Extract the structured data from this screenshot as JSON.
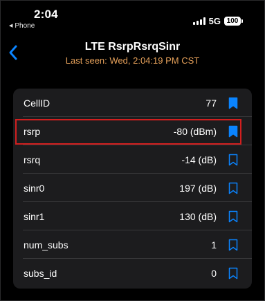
{
  "status_bar": {
    "time": "2:04",
    "back_app": "Phone",
    "network": "5G",
    "battery": "100"
  },
  "header": {
    "title": "LTE RsrpRsrqSinr",
    "last_seen": "Last seen: Wed, 2:04:19 PM CST"
  },
  "rows": [
    {
      "label": "CellID",
      "value": "77",
      "bookmark": "bookmark-filled-icon"
    },
    {
      "label": "rsrp",
      "value": "-80 (dBm)",
      "bookmark": "bookmark-filled-icon"
    },
    {
      "label": "rsrq",
      "value": "-14 (dB)",
      "bookmark": "bookmark-outline-icon"
    },
    {
      "label": "sinr0",
      "value": "197 (dB)",
      "bookmark": "bookmark-outline-icon"
    },
    {
      "label": "sinr1",
      "value": "130 (dB)",
      "bookmark": "bookmark-outline-icon"
    },
    {
      "label": "num_subs",
      "value": "1",
      "bookmark": "bookmark-outline-icon"
    },
    {
      "label": "subs_id",
      "value": "0",
      "bookmark": "bookmark-outline-icon"
    }
  ],
  "highlighted_row": "rsrp",
  "colors": {
    "accent": "#0a84ff",
    "subtitle": "#e5a05a",
    "card": "#1c1c1e",
    "highlight": "#d21f1f"
  }
}
